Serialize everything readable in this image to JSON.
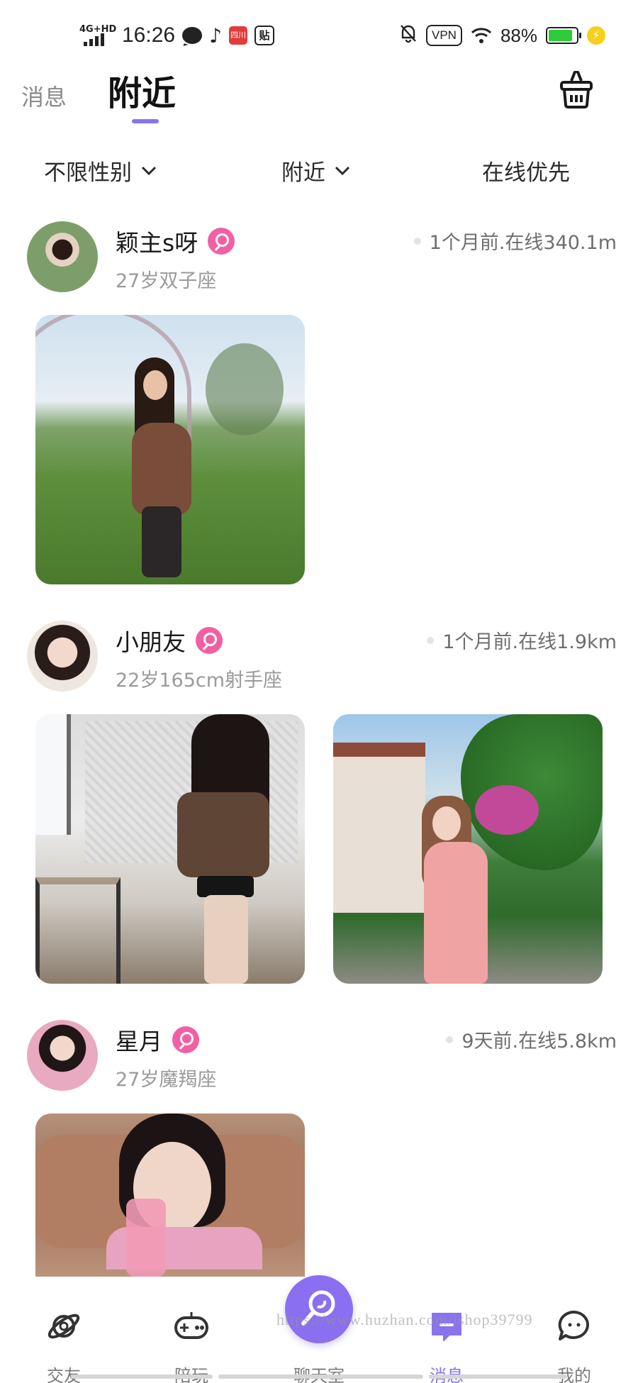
{
  "status_bar": {
    "network": "4G+HD",
    "time": "16:26",
    "app_badge_red": "四川",
    "app_badge_tie": "贴",
    "vpn": "VPN",
    "battery_pct": "88%"
  },
  "header": {
    "tab_messages": "消息",
    "tab_nearby": "附近",
    "active_tab": "附近",
    "clean_icon": "basket-icon"
  },
  "filters": {
    "gender": "不限性别",
    "distance": "附近",
    "online": "在线优先"
  },
  "feed": [
    {
      "name": "颖主s呀",
      "meta": "27岁双子座",
      "status": "1个月前.在线340.1m",
      "photo_count": 1
    },
    {
      "name": "小朋友",
      "meta": "22岁165cm射手座",
      "status": "1个月前.在线1.9km",
      "photo_count": 2
    },
    {
      "name": "星月",
      "meta": "27岁魔羯座",
      "status": "9天前.在线5.8km",
      "photo_count": 1
    }
  ],
  "bottom_nav": {
    "friends": "交友",
    "play": "陪玩",
    "chatroom": "聊天室",
    "messages": "消息",
    "mine": "我的",
    "active": "消息"
  },
  "watermark": "https://www.huzhan.com/ishop39799",
  "colors": {
    "accent": "#8a72f0",
    "female_badge": "#f25fa3",
    "battery": "#2fcc3a"
  }
}
